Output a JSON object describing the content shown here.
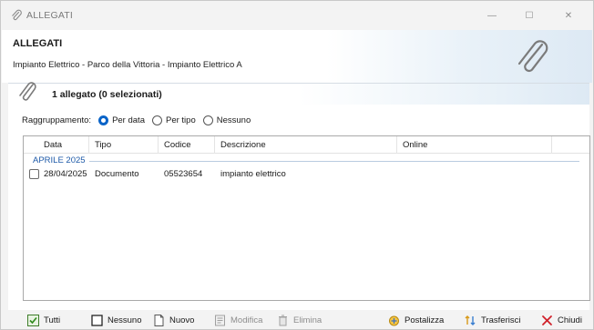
{
  "window": {
    "title": "ALLEGATI",
    "controls": {
      "minimize": "—",
      "maximize": "☐",
      "close": "✕"
    }
  },
  "header": {
    "title": "ALLEGATI",
    "subtitle": "Impianto Elettrico - Parco della Vittoria - Impianto Elettrico A"
  },
  "panel": {
    "count_label": "1 allegato (0 selezionati)",
    "grouping": {
      "label": "Raggruppamento:",
      "options": [
        {
          "label": "Per data",
          "checked": true
        },
        {
          "label": "Per tipo",
          "checked": false
        },
        {
          "label": "Nessuno",
          "checked": false
        }
      ]
    }
  },
  "list": {
    "columns": [
      "Data",
      "Tipo",
      "Codice",
      "Descrizione",
      "Online"
    ],
    "groups": [
      {
        "title": "APRILE 2025",
        "rows": [
          {
            "checked": false,
            "data": "28/04/2025",
            "tipo": "Documento",
            "codice": "05523654",
            "descrizione": "impianto elettrico",
            "online": ""
          }
        ]
      }
    ]
  },
  "toolbar": {
    "tutti": "Tutti",
    "nessuno": "Nessuno",
    "nuovo": "Nuovo",
    "modifica": "Modifica",
    "elimina": "Elimina",
    "postalizza": "Postalizza",
    "trasferisci": "Trasferisci",
    "chiudi": "Chiudi"
  },
  "colors": {
    "accent": "#0a64c8",
    "group_header": "#1e5aa8",
    "close_red": "#d0202a",
    "disabled_text": "#8d8d8d"
  }
}
